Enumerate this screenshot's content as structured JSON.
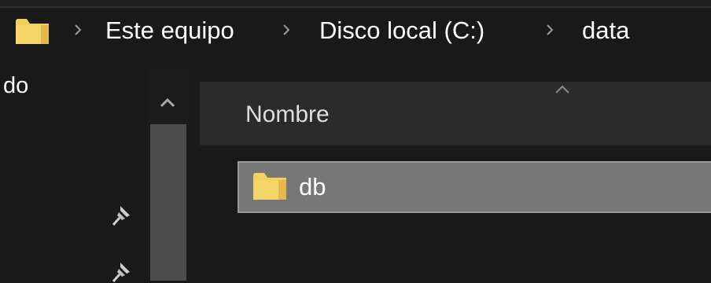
{
  "breadcrumb": {
    "items": [
      {
        "label": "Este equipo",
        "icon": "chevron-right-icon"
      },
      {
        "label": "Disco local (C:)",
        "icon": "chevron-right-icon"
      },
      {
        "label": "data",
        "icon": "chevron-right-icon"
      }
    ],
    "folder_icon": "folder-icon"
  },
  "nav_pane": {
    "partial_label": "do",
    "pin_icons": [
      "pin-icon",
      "pin-icon"
    ]
  },
  "file_list": {
    "columns": [
      {
        "label": "Nombre",
        "sort": "ascending"
      }
    ],
    "rows": [
      {
        "name": "db",
        "type": "folder",
        "selected": true
      }
    ]
  },
  "colors": {
    "background": "#191919",
    "header_bg": "#2b2b2b",
    "selected_row": "#777777",
    "folder_yellow": "#f3cf5e",
    "folder_shadow": "#d9ac3e",
    "text": "#ffffff"
  }
}
